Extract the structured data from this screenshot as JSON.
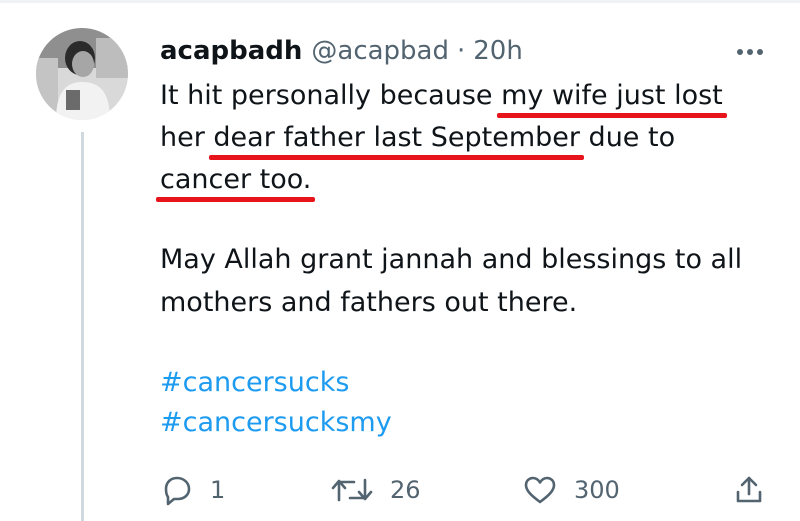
{
  "tweet": {
    "name": "acapbadh",
    "handle": "@acapbad",
    "separator": "·",
    "time": "20h",
    "lines": {
      "l1_a": "It hit personally because ",
      "l1_b": "my wife just lost",
      "l2_a": "her ",
      "l2_b": "dear father last September",
      "l2_c": " due to",
      "l3_a": "cancer too.",
      "p2_l1": "May Allah grant jannah and blessings to all",
      "p2_l2": "mothers and fathers out there."
    },
    "hashtags": [
      "#cancersucks",
      "#cancersucksmy"
    ]
  },
  "actions": {
    "reply_count": "1",
    "retweet_count": "26",
    "like_count": "300"
  },
  "icons": {
    "more": "more-horizontal-icon",
    "reply": "reply-icon",
    "retweet": "retweet-icon",
    "like": "heart-icon",
    "share": "share-icon"
  },
  "colors": {
    "text": "#0f1419",
    "secondary": "#536471",
    "link": "#1d9bf0",
    "highlight_underline": "#e8141b",
    "thread_line": "#cfd9de"
  }
}
